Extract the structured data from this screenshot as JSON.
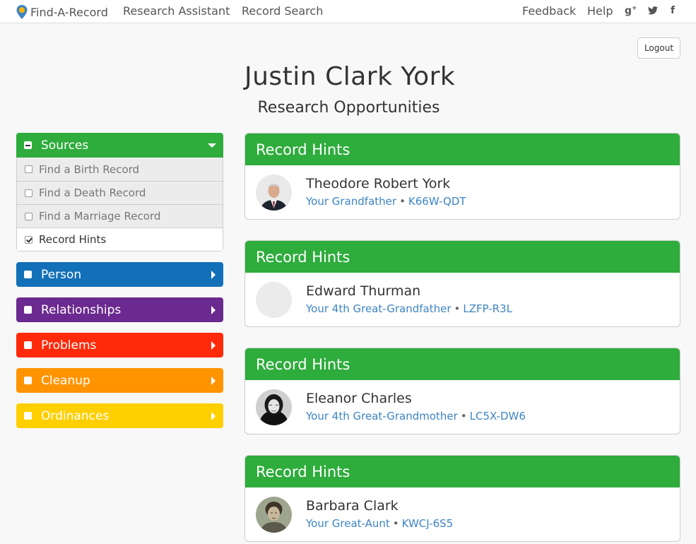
{
  "nav": {
    "brand": "Find-A-Record",
    "links": [
      "Research Assistant",
      "Record Search"
    ],
    "right_links": [
      "Feedback",
      "Help"
    ],
    "social": [
      "g+",
      "twitter",
      "f"
    ]
  },
  "logout_label": "Logout",
  "person": {
    "name": "Justin Clark York",
    "subtitle": "Research Opportunities"
  },
  "sidebar": {
    "sources": {
      "label": "Sources",
      "items": [
        {
          "label": "Find a Birth Record",
          "checked": false
        },
        {
          "label": "Find a Death Record",
          "checked": false
        },
        {
          "label": "Find a Marriage Record",
          "checked": false
        },
        {
          "label": "Record Hints",
          "checked": true
        }
      ]
    },
    "panels": [
      {
        "label": "Person",
        "color": "#1270b8"
      },
      {
        "label": "Relationships",
        "color": "#6b2a8f"
      },
      {
        "label": "Problems",
        "color": "#ff2a0a"
      },
      {
        "label": "Cleanup",
        "color": "#ff9400"
      },
      {
        "label": "Ordinances",
        "color": "#ffcf00"
      }
    ]
  },
  "cards": [
    {
      "title": "Record Hints",
      "name": "Theodore Robert York",
      "relation": "Your Grandfather",
      "pid": "K66W-QDT",
      "avatar": "photo-man-suit"
    },
    {
      "title": "Record Hints",
      "name": "Edward Thurman",
      "relation": "Your 4th Great-Grandfather",
      "pid": "LZFP-R3L",
      "avatar": "placeholder"
    },
    {
      "title": "Record Hints",
      "name": "Eleanor Charles",
      "relation": "Your 4th Great-Grandmother",
      "pid": "LC5X-DW6",
      "avatar": "photo-old-woman"
    },
    {
      "title": "Record Hints",
      "name": "Barbara Clark",
      "relation": "Your Great-Aunt",
      "pid": "KWCJ-6S5",
      "avatar": "photo-young-woman"
    }
  ],
  "colors": {
    "green": "#2eac3c",
    "link": "#3d84c4"
  }
}
